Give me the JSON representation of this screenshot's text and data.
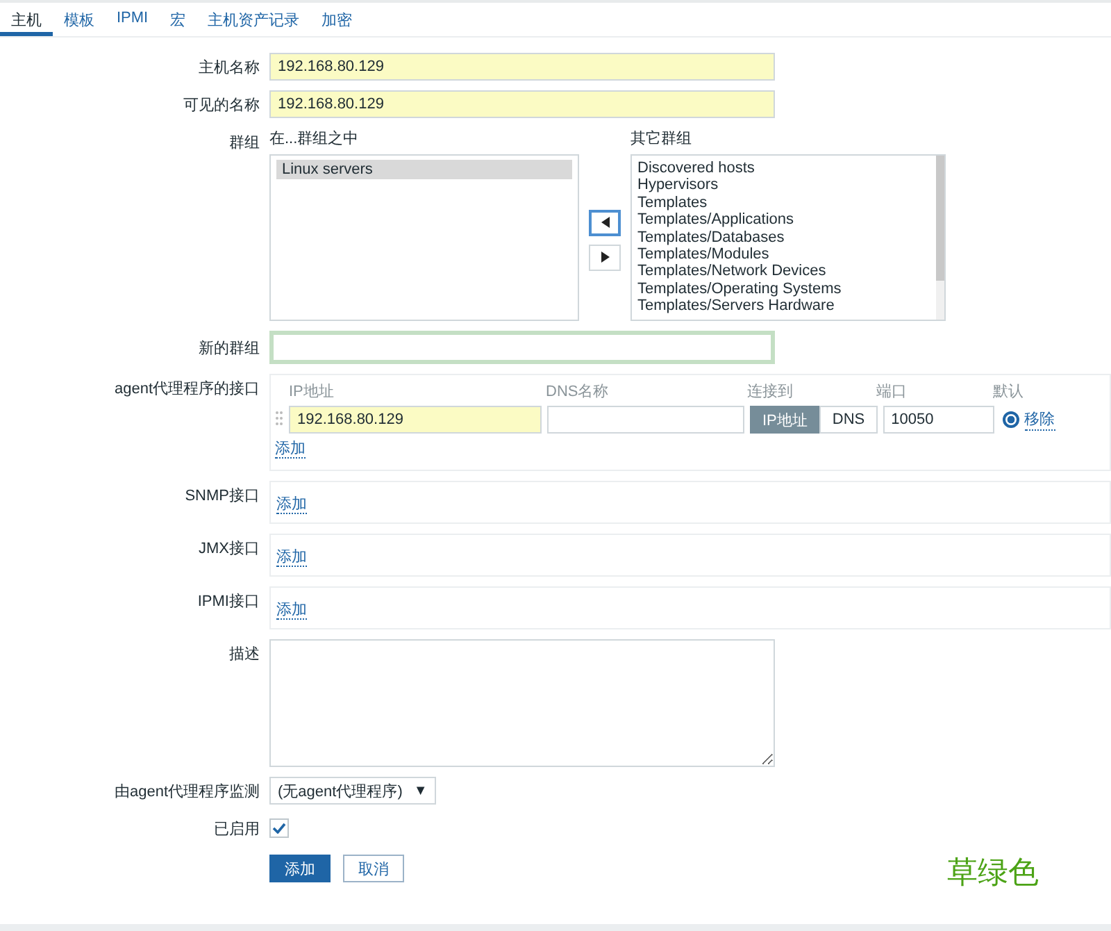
{
  "tabs": [
    {
      "label": "主机",
      "selected": true
    },
    {
      "label": "模板",
      "selected": false
    },
    {
      "label": "IPMI",
      "selected": false
    },
    {
      "label": "宏",
      "selected": false
    },
    {
      "label": "主机资产记录",
      "selected": false
    },
    {
      "label": "加密",
      "selected": false
    }
  ],
  "host_name": {
    "label": "主机名称",
    "value": "192.168.80.129"
  },
  "visible_name": {
    "label": "可见的名称",
    "value": "192.168.80.129"
  },
  "groups": {
    "label": "群组",
    "in_groups_label": "在...群组之中",
    "in_groups": [
      {
        "label": "Linux servers",
        "selected": true
      }
    ],
    "other_groups_label": "其它群组",
    "other_groups": [
      {
        "label": "Discovered hosts",
        "selected": false
      },
      {
        "label": "Hypervisors",
        "selected": false
      },
      {
        "label": "Templates",
        "selected": false
      },
      {
        "label": "Templates/Applications",
        "selected": false
      },
      {
        "label": "Templates/Databases",
        "selected": false
      },
      {
        "label": "Templates/Modules",
        "selected": false
      },
      {
        "label": "Templates/Network Devices",
        "selected": false
      },
      {
        "label": "Templates/Operating Systems",
        "selected": false
      },
      {
        "label": "Templates/Servers Hardware",
        "selected": false
      }
    ]
  },
  "new_group": {
    "label": "新的群组"
  },
  "agent_interface": {
    "label": "agent代理程序的接口",
    "columns": [
      "IP地址",
      "DNS名称",
      "连接到",
      "端口",
      "默认"
    ],
    "ip": "192.168.80.129",
    "connect_to": [
      {
        "label": "IP地址",
        "selected": true
      },
      {
        "label": "DNS",
        "selected": false
      }
    ],
    "port": "10050",
    "default_selected": true,
    "remove": "移除",
    "add": "添加"
  },
  "other_interfaces": [
    {
      "label": "SNMP接口",
      "add": "添加"
    },
    {
      "label": "JMX接口",
      "add": "添加"
    },
    {
      "label": "IPMI接口",
      "add": "添加"
    }
  ],
  "description": {
    "label": "描述"
  },
  "proxy": {
    "label": "由agent代理程序监测",
    "value": "(无agent代理程序)",
    "caret": "▼"
  },
  "enabled": {
    "label": "已启用",
    "checked": true
  },
  "buttons": [
    {
      "label": "添加",
      "kind": "primary"
    },
    {
      "label": "取消",
      "kind": "secondary"
    }
  ],
  "annotation": "草绿色"
}
